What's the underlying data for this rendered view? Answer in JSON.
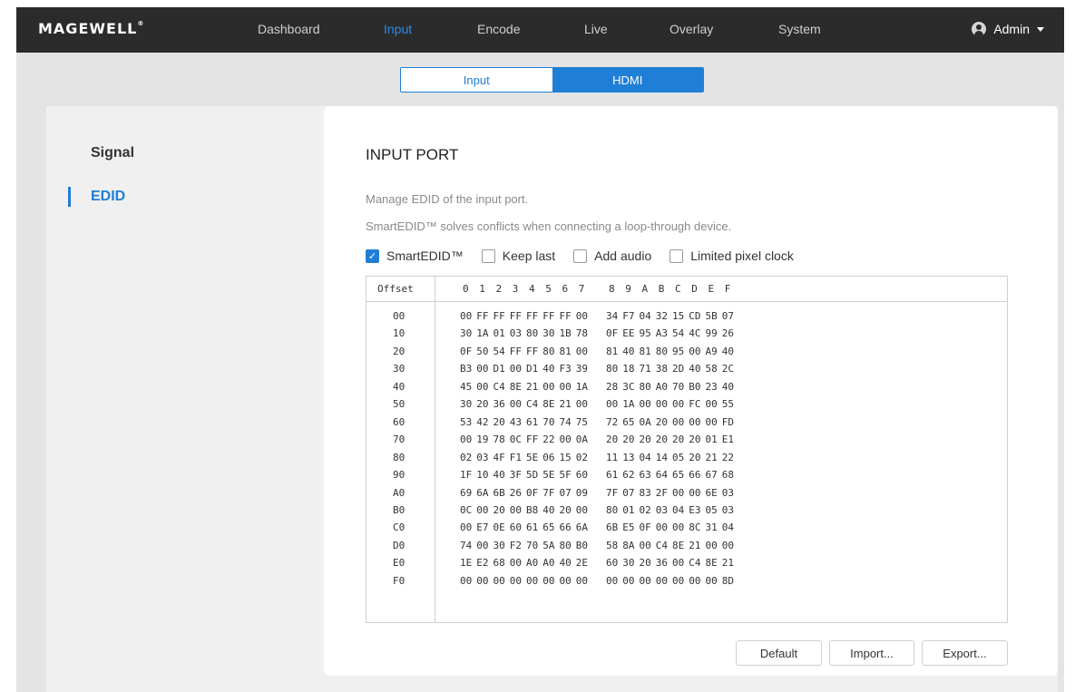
{
  "navbar": {
    "logo": "MAGEWELL",
    "logo_mark": "®",
    "items": [
      {
        "label": "Dashboard",
        "active": false
      },
      {
        "label": "Input",
        "active": true
      },
      {
        "label": "Encode",
        "active": false
      },
      {
        "label": "Live",
        "active": false
      },
      {
        "label": "Overlay",
        "active": false
      },
      {
        "label": "System",
        "active": false
      }
    ],
    "user": "Admin"
  },
  "subtabs": [
    {
      "label": "Input",
      "active": false
    },
    {
      "label": "HDMI",
      "active": true
    }
  ],
  "sidebar": {
    "items": [
      {
        "label": "Signal",
        "active": false
      },
      {
        "label": "EDID",
        "active": true
      }
    ]
  },
  "card": {
    "title": "INPUT PORT",
    "desc1": "Manage EDID of the input port.",
    "desc2": "SmartEDID™ solves conflicts when connecting a loop-through device.",
    "options": [
      {
        "label": "SmartEDID™",
        "checked": true
      },
      {
        "label": "Keep last",
        "checked": false
      },
      {
        "label": "Add audio",
        "checked": false
      },
      {
        "label": "Limited pixel clock",
        "checked": false
      }
    ],
    "edid": {
      "offset_header": "Offset",
      "col_headers": [
        "0",
        "1",
        "2",
        "3",
        "4",
        "5",
        "6",
        "7",
        "8",
        "9",
        "A",
        "B",
        "C",
        "D",
        "E",
        "F"
      ],
      "rows": [
        {
          "offset": "00",
          "bytes": [
            "00",
            "FF",
            "FF",
            "FF",
            "FF",
            "FF",
            "FF",
            "00",
            "34",
            "F7",
            "04",
            "32",
            "15",
            "CD",
            "5B",
            "07"
          ]
        },
        {
          "offset": "10",
          "bytes": [
            "30",
            "1A",
            "01",
            "03",
            "80",
            "30",
            "1B",
            "78",
            "0F",
            "EE",
            "95",
            "A3",
            "54",
            "4C",
            "99",
            "26"
          ]
        },
        {
          "offset": "20",
          "bytes": [
            "0F",
            "50",
            "54",
            "FF",
            "FF",
            "80",
            "81",
            "00",
            "81",
            "40",
            "81",
            "80",
            "95",
            "00",
            "A9",
            "40"
          ]
        },
        {
          "offset": "30",
          "bytes": [
            "B3",
            "00",
            "D1",
            "00",
            "D1",
            "40",
            "F3",
            "39",
            "80",
            "18",
            "71",
            "38",
            "2D",
            "40",
            "58",
            "2C"
          ]
        },
        {
          "offset": "40",
          "bytes": [
            "45",
            "00",
            "C4",
            "8E",
            "21",
            "00",
            "00",
            "1A",
            "28",
            "3C",
            "80",
            "A0",
            "70",
            "B0",
            "23",
            "40"
          ]
        },
        {
          "offset": "50",
          "bytes": [
            "30",
            "20",
            "36",
            "00",
            "C4",
            "8E",
            "21",
            "00",
            "00",
            "1A",
            "00",
            "00",
            "00",
            "FC",
            "00",
            "55"
          ]
        },
        {
          "offset": "60",
          "bytes": [
            "53",
            "42",
            "20",
            "43",
            "61",
            "70",
            "74",
            "75",
            "72",
            "65",
            "0A",
            "20",
            "00",
            "00",
            "00",
            "FD"
          ]
        },
        {
          "offset": "70",
          "bytes": [
            "00",
            "19",
            "78",
            "0C",
            "FF",
            "22",
            "00",
            "0A",
            "20",
            "20",
            "20",
            "20",
            "20",
            "20",
            "01",
            "E1"
          ]
        },
        {
          "offset": "80",
          "bytes": [
            "02",
            "03",
            "4F",
            "F1",
            "5E",
            "06",
            "15",
            "02",
            "11",
            "13",
            "04",
            "14",
            "05",
            "20",
            "21",
            "22"
          ]
        },
        {
          "offset": "90",
          "bytes": [
            "1F",
            "10",
            "40",
            "3F",
            "5D",
            "5E",
            "5F",
            "60",
            "61",
            "62",
            "63",
            "64",
            "65",
            "66",
            "67",
            "68"
          ]
        },
        {
          "offset": "A0",
          "bytes": [
            "69",
            "6A",
            "6B",
            "26",
            "0F",
            "7F",
            "07",
            "09",
            "7F",
            "07",
            "83",
            "2F",
            "00",
            "00",
            "6E",
            "03"
          ]
        },
        {
          "offset": "B0",
          "bytes": [
            "0C",
            "00",
            "20",
            "00",
            "B8",
            "40",
            "20",
            "00",
            "80",
            "01",
            "02",
            "03",
            "04",
            "E3",
            "05",
            "03"
          ]
        },
        {
          "offset": "C0",
          "bytes": [
            "00",
            "E7",
            "0E",
            "60",
            "61",
            "65",
            "66",
            "6A",
            "6B",
            "E5",
            "0F",
            "00",
            "00",
            "8C",
            "31",
            "04"
          ]
        },
        {
          "offset": "D0",
          "bytes": [
            "74",
            "00",
            "30",
            "F2",
            "70",
            "5A",
            "80",
            "B0",
            "58",
            "8A",
            "00",
            "C4",
            "8E",
            "21",
            "00",
            "00"
          ]
        },
        {
          "offset": "E0",
          "bytes": [
            "1E",
            "E2",
            "68",
            "00",
            "A0",
            "A0",
            "40",
            "2E",
            "60",
            "30",
            "20",
            "36",
            "00",
            "C4",
            "8E",
            "21"
          ]
        },
        {
          "offset": "F0",
          "bytes": [
            "00",
            "00",
            "00",
            "00",
            "00",
            "00",
            "00",
            "00",
            "00",
            "00",
            "00",
            "00",
            "00",
            "00",
            "00",
            "8D"
          ]
        }
      ]
    },
    "buttons": {
      "default_label": "Default",
      "import_label": "Import...",
      "export_label": "Export..."
    }
  }
}
